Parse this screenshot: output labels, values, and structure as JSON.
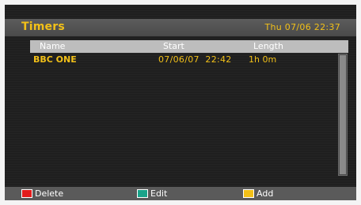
{
  "header": {
    "title": "Timers",
    "datetime": "Thu 07/06 22:37"
  },
  "table": {
    "columns": [
      "Name",
      "Start",
      "Length"
    ],
    "rows": [
      {
        "name": "BBC ONE",
        "start": "07/06/07  22:42",
        "length": "1h 0m"
      }
    ]
  },
  "footer": {
    "keys": [
      {
        "label": "Delete",
        "color": "#e21b1b",
        "icon": "red-key-icon"
      },
      {
        "label": "Edit",
        "color": "#1aa38a",
        "icon": "green-key-icon"
      },
      {
        "label": "Add",
        "color": "#f2c018",
        "icon": "yellow-key-icon"
      }
    ]
  },
  "colors": {
    "accent": "#f2c018",
    "background": "#1f1f1f",
    "bar": "#5a5a5a",
    "header_row": "#bdbdbd"
  }
}
